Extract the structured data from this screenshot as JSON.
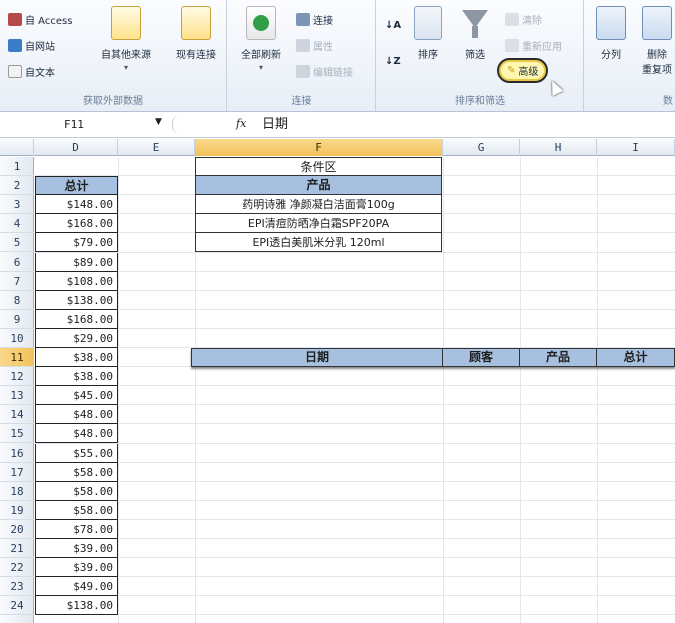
{
  "ribbon": {
    "get_external": {
      "from_access": "自 Access",
      "from_web": "自网站",
      "from_text": "自文本",
      "from_other": "自其他来源",
      "existing": "现有连接",
      "label": "获取外部数据"
    },
    "connections": {
      "refresh_all": "全部刷新",
      "connections": "连接",
      "properties": "属性",
      "edit_links": "编辑链接",
      "label": "连接"
    },
    "sort_filter": {
      "sort": "排序",
      "filter": "筛选",
      "clear": "清除",
      "reapply": "重新应用",
      "advanced": "高级",
      "label": "排序和筛选"
    },
    "data_tools": {
      "split": "分列",
      "remove_dup_1": "删除",
      "remove_dup_2": "重复项",
      "label": "数"
    }
  },
  "formula_bar": {
    "name_box": "F11",
    "fx": "fx",
    "content": "日期"
  },
  "columns": [
    "D",
    "E",
    "F",
    "G",
    "H",
    "I"
  ],
  "rows": [
    "1",
    "2",
    "3",
    "4",
    "5",
    "6",
    "7",
    "8",
    "9",
    "10",
    "11",
    "12",
    "13",
    "14",
    "15",
    "16",
    "17",
    "18",
    "19",
    "20",
    "21",
    "22",
    "23",
    "24"
  ],
  "totals": {
    "header": "总计",
    "values": [
      "$148.00",
      "$168.00",
      "$79.00",
      "$89.00",
      "$108.00",
      "$138.00",
      "$168.00",
      "$29.00",
      "$38.00",
      "$38.00",
      "$45.00",
      "$48.00",
      "$48.00",
      "$55.00",
      "$58.00",
      "$58.00",
      "$58.00",
      "$78.00",
      "$39.00",
      "$39.00",
      "$49.00",
      "$138.00"
    ]
  },
  "criteria": {
    "title": "条件区",
    "header": "产品",
    "items": [
      "药明诗雅 净颜凝白洁面膏100g",
      "EPI清痘防晒净白霜SPF20PA",
      "EPI透白美肌米分乳 120ml"
    ]
  },
  "output_header": [
    "日期",
    "顾客",
    "产品",
    "总计"
  ]
}
